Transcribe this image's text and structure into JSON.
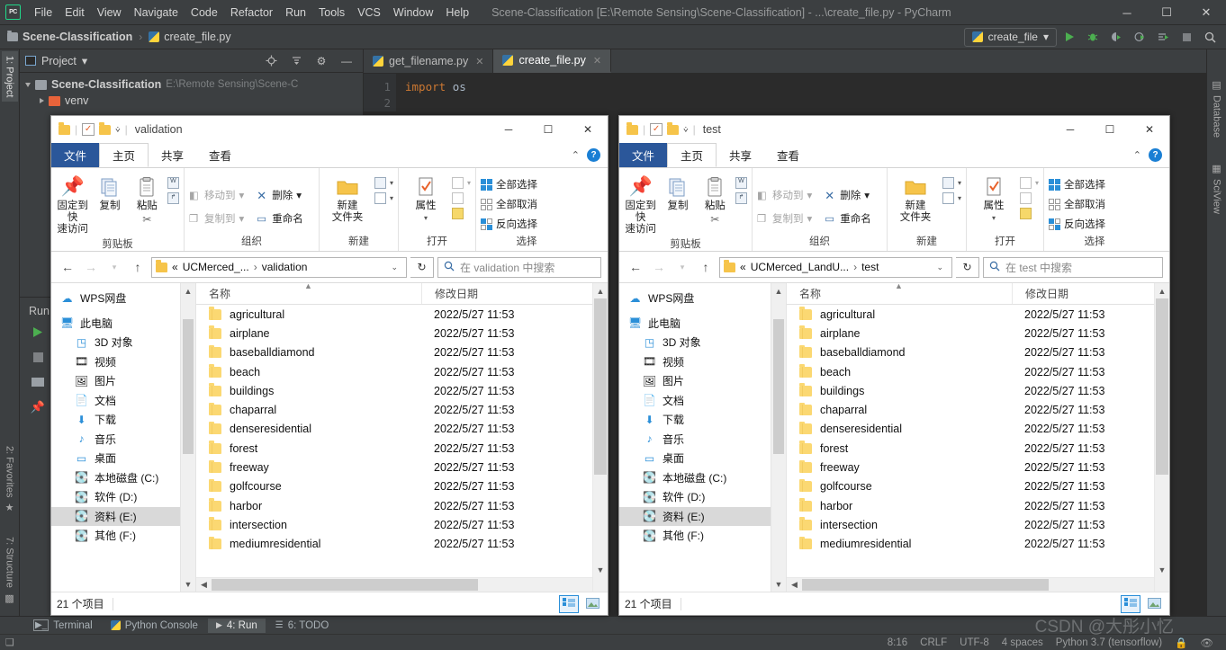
{
  "ide": {
    "window_title": "Scene-Classification [E:\\Remote Sensing\\Scene-Classification] - ...\\create_file.py - PyCharm",
    "logo": "PC",
    "menu": [
      "File",
      "Edit",
      "View",
      "Navigate",
      "Code",
      "Refactor",
      "Run",
      "Tools",
      "VCS",
      "Window",
      "Help"
    ],
    "window_buttons": {
      "minimize": "─",
      "maximize": "☐",
      "close": "✕"
    },
    "navbar": {
      "project_crumb": "Scene-Classification",
      "separator": "›",
      "file_crumb": "create_file.py"
    },
    "run_config": {
      "name": "create_file",
      "chevron": "▾"
    },
    "toolbar_icons": [
      "run-icon",
      "debug-icon",
      "coverage-icon",
      "profile-icon",
      "run-with-console-icon",
      "stop-icon",
      "search-everywhere-icon"
    ],
    "project_panel": {
      "title": "Project",
      "chevron": "▾",
      "tree": [
        {
          "label": "Scene-Classification",
          "path": "E:\\Remote Sensing\\Scene-C",
          "expanded": true
        },
        {
          "label": "venv",
          "path": "",
          "expanded": false
        }
      ]
    },
    "editor_tabs": [
      {
        "label": "get_filename.py",
        "active": false
      },
      {
        "label": "create_file.py",
        "active": true
      }
    ],
    "code": {
      "lines": [
        "1",
        "2"
      ],
      "line1_kw": "import",
      "line1_mod": "os"
    },
    "left_rail": [
      "1: Project",
      "2: Favorites",
      "7: Structure"
    ],
    "right_rail": [
      "Database",
      "SciView"
    ],
    "run_panel": {
      "label": "Run:"
    },
    "status_tools": [
      {
        "label": "Terminal",
        "icon": "terminal-icon",
        "active": false
      },
      {
        "label": "Python Console",
        "icon": "python-icon",
        "active": false
      },
      {
        "label": "4: Run",
        "icon": "run-icon",
        "active": true
      },
      {
        "label": "6: TODO",
        "icon": "todo-icon",
        "active": false
      }
    ],
    "status_right": [
      "8:16",
      "CRLF",
      "UTF-8",
      "4 spaces",
      "Python 3.7 (tensorflow)"
    ],
    "watermark": "CSDN @大彤小忆"
  },
  "explorer_left": {
    "title": "validation",
    "quick_access_icons": [
      "folder-icon",
      "properties-icon",
      "new-folder-icon",
      "customize-chevron-icon"
    ],
    "window_buttons": {
      "minimize": "─",
      "maximize": "☐",
      "close": "✕"
    },
    "ribbon_tabs": [
      {
        "label": "文件",
        "kind": "file"
      },
      {
        "label": "主页",
        "kind": "active"
      },
      {
        "label": "共享",
        "kind": "normal"
      },
      {
        "label": "查看",
        "kind": "normal"
      }
    ],
    "ribbon_collapse": "⌃",
    "ribbon_help": "?",
    "ribbon_groups": [
      {
        "title": "剪贴板",
        "big": [
          {
            "label": "固定到快\n速访问",
            "icon": "pin-icon"
          },
          {
            "label": "复制",
            "icon": "copy-icon"
          },
          {
            "label": "粘贴",
            "icon": "paste-icon"
          }
        ],
        "small": [
          {
            "label": "剪切",
            "icon": "scissors-icon",
            "disabled": false
          },
          {
            "label": "复制路径",
            "icon": "copy-path-icon",
            "disabled": false
          },
          {
            "label": "粘贴快捷方式",
            "icon": "paste-shortcut-icon",
            "disabled": false
          }
        ]
      },
      {
        "title": "组织",
        "items": [
          {
            "label": "移动到",
            "icon": "move-to-icon",
            "disabled": true,
            "chevron": "▾"
          },
          {
            "label": "删除",
            "icon": "delete-icon",
            "disabled": false,
            "chevron": "▾"
          },
          {
            "label": "复制到",
            "icon": "copy-to-icon",
            "disabled": true,
            "chevron": "▾"
          },
          {
            "label": "重命名",
            "icon": "rename-icon",
            "disabled": false,
            "chevron": ""
          }
        ]
      },
      {
        "title": "新建",
        "big": [
          {
            "label": "新建\n文件夹",
            "icon": "new-folder-icon"
          }
        ],
        "small": [
          {
            "label": "",
            "icon": "new-item-icon"
          },
          {
            "label": "",
            "icon": "easy-access-icon"
          }
        ]
      },
      {
        "title": "打开",
        "big": [
          {
            "label": "属性",
            "icon": "properties-icon"
          }
        ],
        "small": [
          {
            "label": "",
            "icon": "open-icon"
          },
          {
            "label": "",
            "icon": "edit-icon"
          },
          {
            "label": "",
            "icon": "history-icon"
          }
        ]
      },
      {
        "title": "选择",
        "items": [
          {
            "label": "全部选择",
            "icon": "select-all-icon"
          },
          {
            "label": "全部取消",
            "icon": "select-none-icon"
          },
          {
            "label": "反向选择",
            "icon": "invert-selection-icon"
          }
        ]
      }
    ],
    "address": {
      "back": "←",
      "forward": "→",
      "recent": "⌵",
      "up": "↑",
      "crumbs": [
        "«",
        "UCMerced_...",
        "›",
        "validation"
      ],
      "chevron": "⌄",
      "refresh": "↻"
    },
    "search_placeholder": "在 validation 中搜索",
    "nav_pane": [
      {
        "label": "WPS网盘",
        "icon": "cloud-icon",
        "indent": 0,
        "selected": false
      },
      {
        "label": "此电脑",
        "icon": "computer-icon",
        "indent": 0,
        "selected": false
      },
      {
        "label": "3D 对象",
        "icon": "3d-objects-icon",
        "indent": 1,
        "selected": false
      },
      {
        "label": "视频",
        "icon": "videos-icon",
        "indent": 1,
        "selected": false
      },
      {
        "label": "图片",
        "icon": "pictures-icon",
        "indent": 1,
        "selected": false
      },
      {
        "label": "文档",
        "icon": "documents-icon",
        "indent": 1,
        "selected": false
      },
      {
        "label": "下载",
        "icon": "downloads-icon",
        "indent": 1,
        "selected": false
      },
      {
        "label": "音乐",
        "icon": "music-icon",
        "indent": 1,
        "selected": false
      },
      {
        "label": "桌面",
        "icon": "desktop-icon",
        "indent": 1,
        "selected": false
      },
      {
        "label": "本地磁盘 (C:)",
        "icon": "drive-icon",
        "indent": 1,
        "selected": false
      },
      {
        "label": "软件 (D:)",
        "icon": "drive-icon",
        "indent": 1,
        "selected": false
      },
      {
        "label": "资料 (E:)",
        "icon": "drive-icon",
        "indent": 1,
        "selected": true
      },
      {
        "label": "其他 (F:)",
        "icon": "drive-icon",
        "indent": 1,
        "selected": false
      }
    ],
    "columns": {
      "name": "名称",
      "date": "修改日期"
    },
    "files": [
      {
        "name": "agricultural",
        "date": "2022/5/27 11:53"
      },
      {
        "name": "airplane",
        "date": "2022/5/27 11:53"
      },
      {
        "name": "baseballdiamond",
        "date": "2022/5/27 11:53"
      },
      {
        "name": "beach",
        "date": "2022/5/27 11:53"
      },
      {
        "name": "buildings",
        "date": "2022/5/27 11:53"
      },
      {
        "name": "chaparral",
        "date": "2022/5/27 11:53"
      },
      {
        "name": "denseresidential",
        "date": "2022/5/27 11:53"
      },
      {
        "name": "forest",
        "date": "2022/5/27 11:53"
      },
      {
        "name": "freeway",
        "date": "2022/5/27 11:53"
      },
      {
        "name": "golfcourse",
        "date": "2022/5/27 11:53"
      },
      {
        "name": "harbor",
        "date": "2022/5/27 11:53"
      },
      {
        "name": "intersection",
        "date": "2022/5/27 11:53"
      },
      {
        "name": "mediumresidential",
        "date": "2022/5/27 11:53"
      }
    ],
    "status_count": "21 个项目",
    "view_buttons": [
      "details-view-icon",
      "large-icons-view-icon"
    ]
  },
  "explorer_right": {
    "title": "test",
    "window_buttons": {
      "minimize": "─",
      "maximize": "☐",
      "close": "✕"
    },
    "ribbon_tabs": [
      {
        "label": "文件",
        "kind": "file"
      },
      {
        "label": "主页",
        "kind": "active"
      },
      {
        "label": "共享",
        "kind": "normal"
      },
      {
        "label": "查看",
        "kind": "normal"
      }
    ],
    "address": {
      "back": "←",
      "forward": "→",
      "recent": "⌵",
      "up": "↑",
      "crumbs": [
        "«",
        "UCMerced_LandU...",
        "›",
        "test"
      ],
      "chevron": "⌄",
      "refresh": "↻"
    },
    "search_placeholder": "在 test 中搜索",
    "columns": {
      "name": "名称",
      "date": "修改日期"
    },
    "files": [
      {
        "name": "agricultural",
        "date": "2022/5/27 11:53"
      },
      {
        "name": "airplane",
        "date": "2022/5/27 11:53"
      },
      {
        "name": "baseballdiamond",
        "date": "2022/5/27 11:53"
      },
      {
        "name": "beach",
        "date": "2022/5/27 11:53"
      },
      {
        "name": "buildings",
        "date": "2022/5/27 11:53"
      },
      {
        "name": "chaparral",
        "date": "2022/5/27 11:53"
      },
      {
        "name": "denseresidential",
        "date": "2022/5/27 11:53"
      },
      {
        "name": "forest",
        "date": "2022/5/27 11:53"
      },
      {
        "name": "freeway",
        "date": "2022/5/27 11:53"
      },
      {
        "name": "golfcourse",
        "date": "2022/5/27 11:53"
      },
      {
        "name": "harbor",
        "date": "2022/5/27 11:53"
      },
      {
        "name": "intersection",
        "date": "2022/5/27 11:53"
      },
      {
        "name": "mediumresidential",
        "date": "2022/5/27 11:53"
      }
    ],
    "status_count": "21 个项目"
  },
  "colors": {
    "ide_bg": "#3c3f41",
    "editor_bg": "#2b2b2b",
    "accent_blue": "#2b579a",
    "folder_yellow": "#fbd872",
    "selection_blue": "#cfe0f2"
  }
}
